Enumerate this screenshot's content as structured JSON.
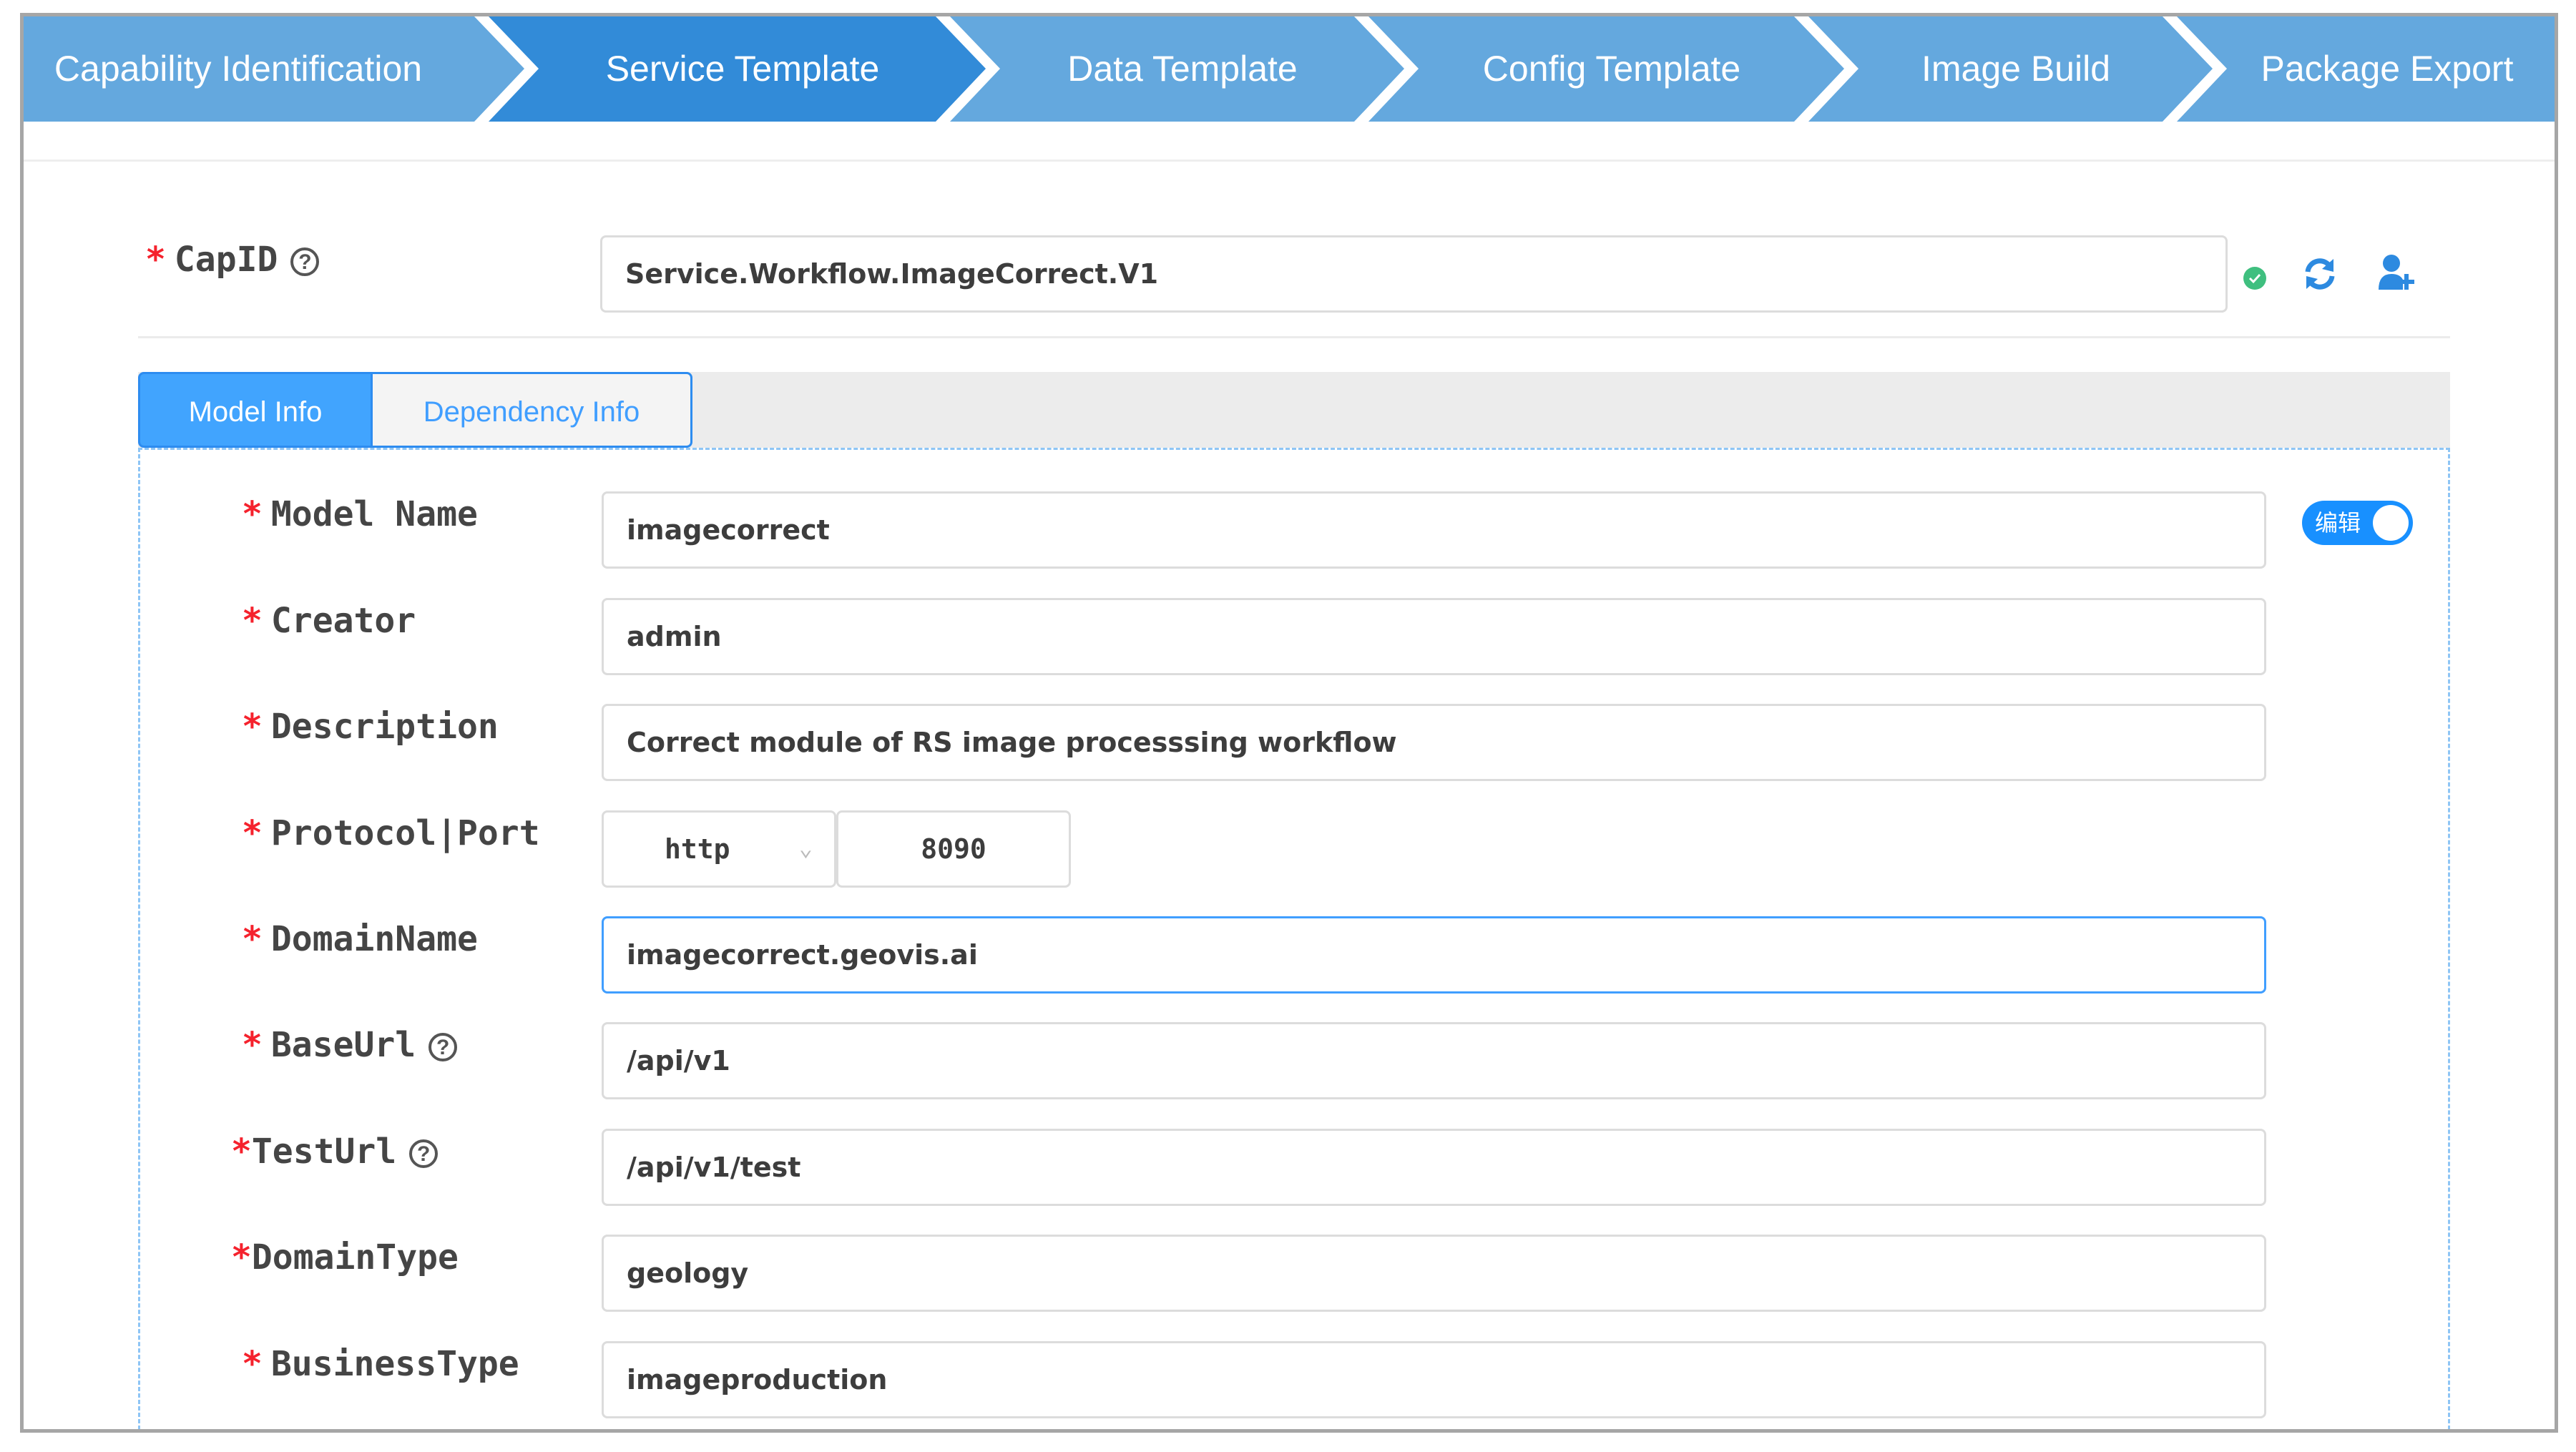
{
  "steps": [
    {
      "label": "Capability Identification",
      "state": "done"
    },
    {
      "label": "Service Template",
      "state": "active"
    },
    {
      "label": "Data Template",
      "state": "pending"
    },
    {
      "label": "Config Template",
      "state": "pending"
    },
    {
      "label": "Image Build",
      "state": "pending"
    },
    {
      "label": "Package Export",
      "state": "pending"
    }
  ],
  "colors": {
    "step_active": "#328bd8",
    "step_inactive": "#64a8de",
    "accent": "#409eff",
    "required": "#f5222d",
    "success": "#3fbf7f"
  },
  "capid": {
    "label": "CapID",
    "value": "Service.Workflow.ImageCorrect.V1",
    "status_icon": "check-circle-icon",
    "refresh_icon": "refresh-icon",
    "add_user_icon": "user-plus-icon"
  },
  "tabs": [
    {
      "label": "Model Info",
      "active": true
    },
    {
      "label": "Dependency Info",
      "active": false
    }
  ],
  "toggle": {
    "label": "编辑",
    "on": true
  },
  "form": {
    "model_name": {
      "label": "Model Name",
      "value": "imagecorrect"
    },
    "creator": {
      "label": "Creator",
      "value": "admin"
    },
    "description": {
      "label": "Description",
      "value": "Correct module of RS image processsing workflow"
    },
    "protocol_port": {
      "label": "Protocol|Port",
      "protocol": "http",
      "port": "8090"
    },
    "domain_name": {
      "label": "DomainName",
      "value": "imagecorrect.geovis.ai"
    },
    "base_url": {
      "label": "BaseUrl",
      "value": "/api/v1"
    },
    "test_url": {
      "label": "TestUrl",
      "value": "/api/v1/test"
    },
    "domain_type": {
      "label": "DomainType",
      "value": "geology"
    },
    "business_type": {
      "label": "BusinessType",
      "value": "imageproduction"
    }
  },
  "required_mark": "*",
  "help_mark": "?"
}
